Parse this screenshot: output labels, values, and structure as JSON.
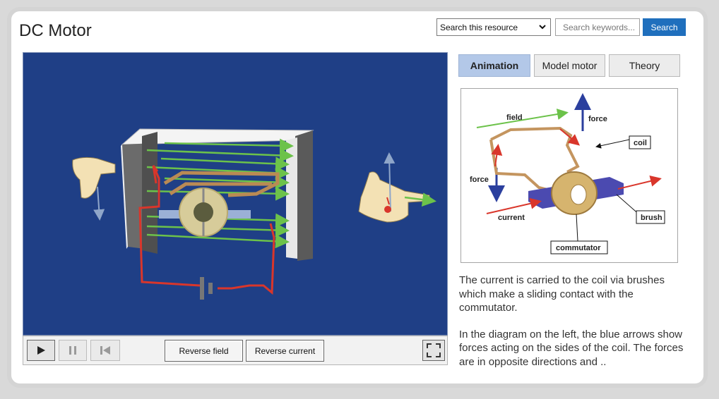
{
  "page": {
    "title": "DC Motor"
  },
  "search": {
    "scope_selected": "Search this resource",
    "placeholder": "Search keywords...",
    "button_label": "Search"
  },
  "tabs": [
    {
      "label": "Animation",
      "active": true
    },
    {
      "label": "Model motor",
      "active": false
    },
    {
      "label": "Theory",
      "active": false
    }
  ],
  "controls": {
    "play_icon": "play-icon",
    "pause_icon": "pause-icon",
    "rewind_icon": "skip-back-icon",
    "reverse_field_label": "Reverse field",
    "reverse_current_label": "Reverse current",
    "fullscreen_icon": "fullscreen-icon"
  },
  "diagram": {
    "labels": {
      "field": "field",
      "force_top": "force",
      "coil": "coil",
      "force_left": "force",
      "current": "current",
      "brush": "brush",
      "commutator": "commutator"
    }
  },
  "description": {
    "paragraph1": "The current is carried to the coil via brushes which make a sliding contact with the commutator.",
    "paragraph2": "In the diagram on the left, the blue arrows show forces acting on the sides of the coil. The forces are in opposite directions and .."
  },
  "colors": {
    "sim_background": "#1f3f86",
    "accent_button": "#1f6fbd",
    "active_tab": "#b3c8e8",
    "field_arrow": "#6cc24a",
    "current_wire": "#d9362b",
    "force_arrow": "#2b3f9e"
  }
}
